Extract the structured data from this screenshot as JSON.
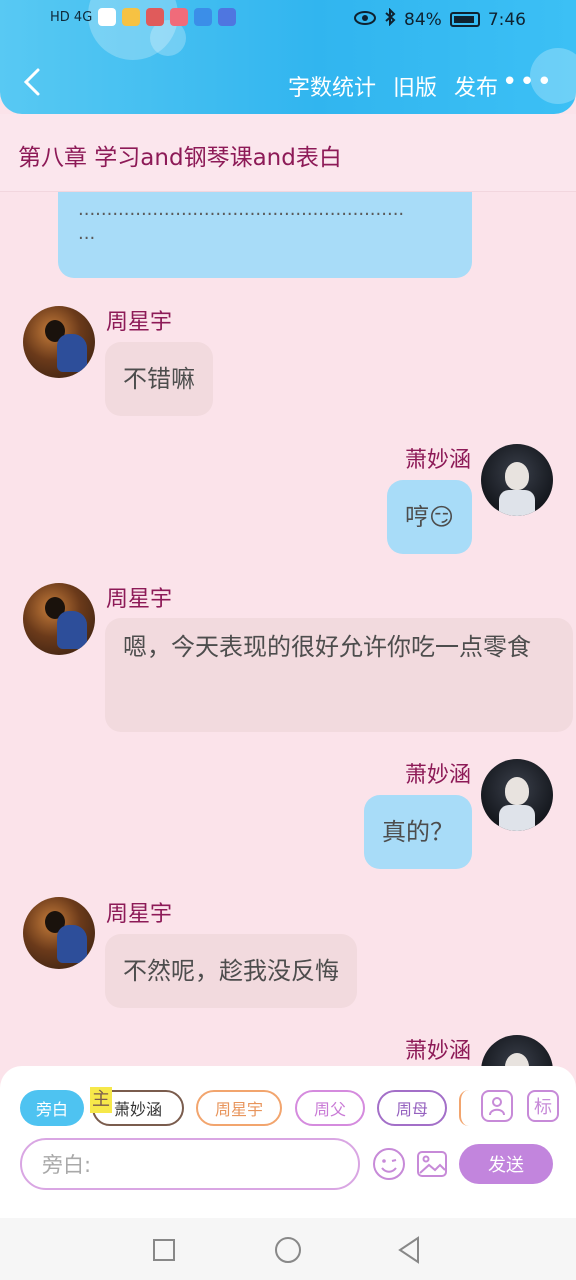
{
  "status_bar": {
    "left_label": "HD 4G",
    "eye_icon": "eye-icon",
    "bluetooth_icon": "bluetooth-icon",
    "battery_percent": "84%",
    "time": "7:46"
  },
  "header": {
    "actions": [
      "字数统计",
      "旧版",
      "发布"
    ],
    "more_label": "•••"
  },
  "chapter": {
    "title": "第八章  学习and钢琴课and表白"
  },
  "messages": [
    {
      "side": "right",
      "text": ".........................................................\n..."
    },
    {
      "side": "left",
      "name": "周星宇",
      "text": "不错嘛"
    },
    {
      "side": "right",
      "name": "萧妙涵",
      "text": "哼😏"
    },
    {
      "side": "left",
      "name": "周星宇",
      "text": "嗯，今天表现的很好允许你吃一点零食"
    },
    {
      "side": "right",
      "name": "萧妙涵",
      "text": "真的？"
    },
    {
      "side": "left",
      "name": "周星宇",
      "text": "不然呢，趁我没反悔"
    },
    {
      "side": "right",
      "name": "萧妙涵"
    }
  ],
  "composer": {
    "chips": [
      {
        "label": "旁白",
        "color": "#4ec3f1"
      },
      {
        "label": "主",
        "color": "#f6e84a"
      },
      {
        "label": "萧妙涵",
        "color": "#7a5c4d"
      },
      {
        "label": "周星宇",
        "color": "#f2a56e"
      },
      {
        "label": "周父",
        "color": "#d58bde"
      },
      {
        "label": "周母",
        "color": "#a36fc8"
      }
    ],
    "mark_label": "标",
    "placeholder": "旁白:",
    "send_label": "发送"
  },
  "colors": {
    "header_blue": "#31b5ef",
    "name_color": "#8d1a57",
    "right_bubble": "#a8dcf8",
    "left_bubble": "#f2dade",
    "send_button": "#c285dd",
    "page_bg": "#fbe3ea"
  }
}
